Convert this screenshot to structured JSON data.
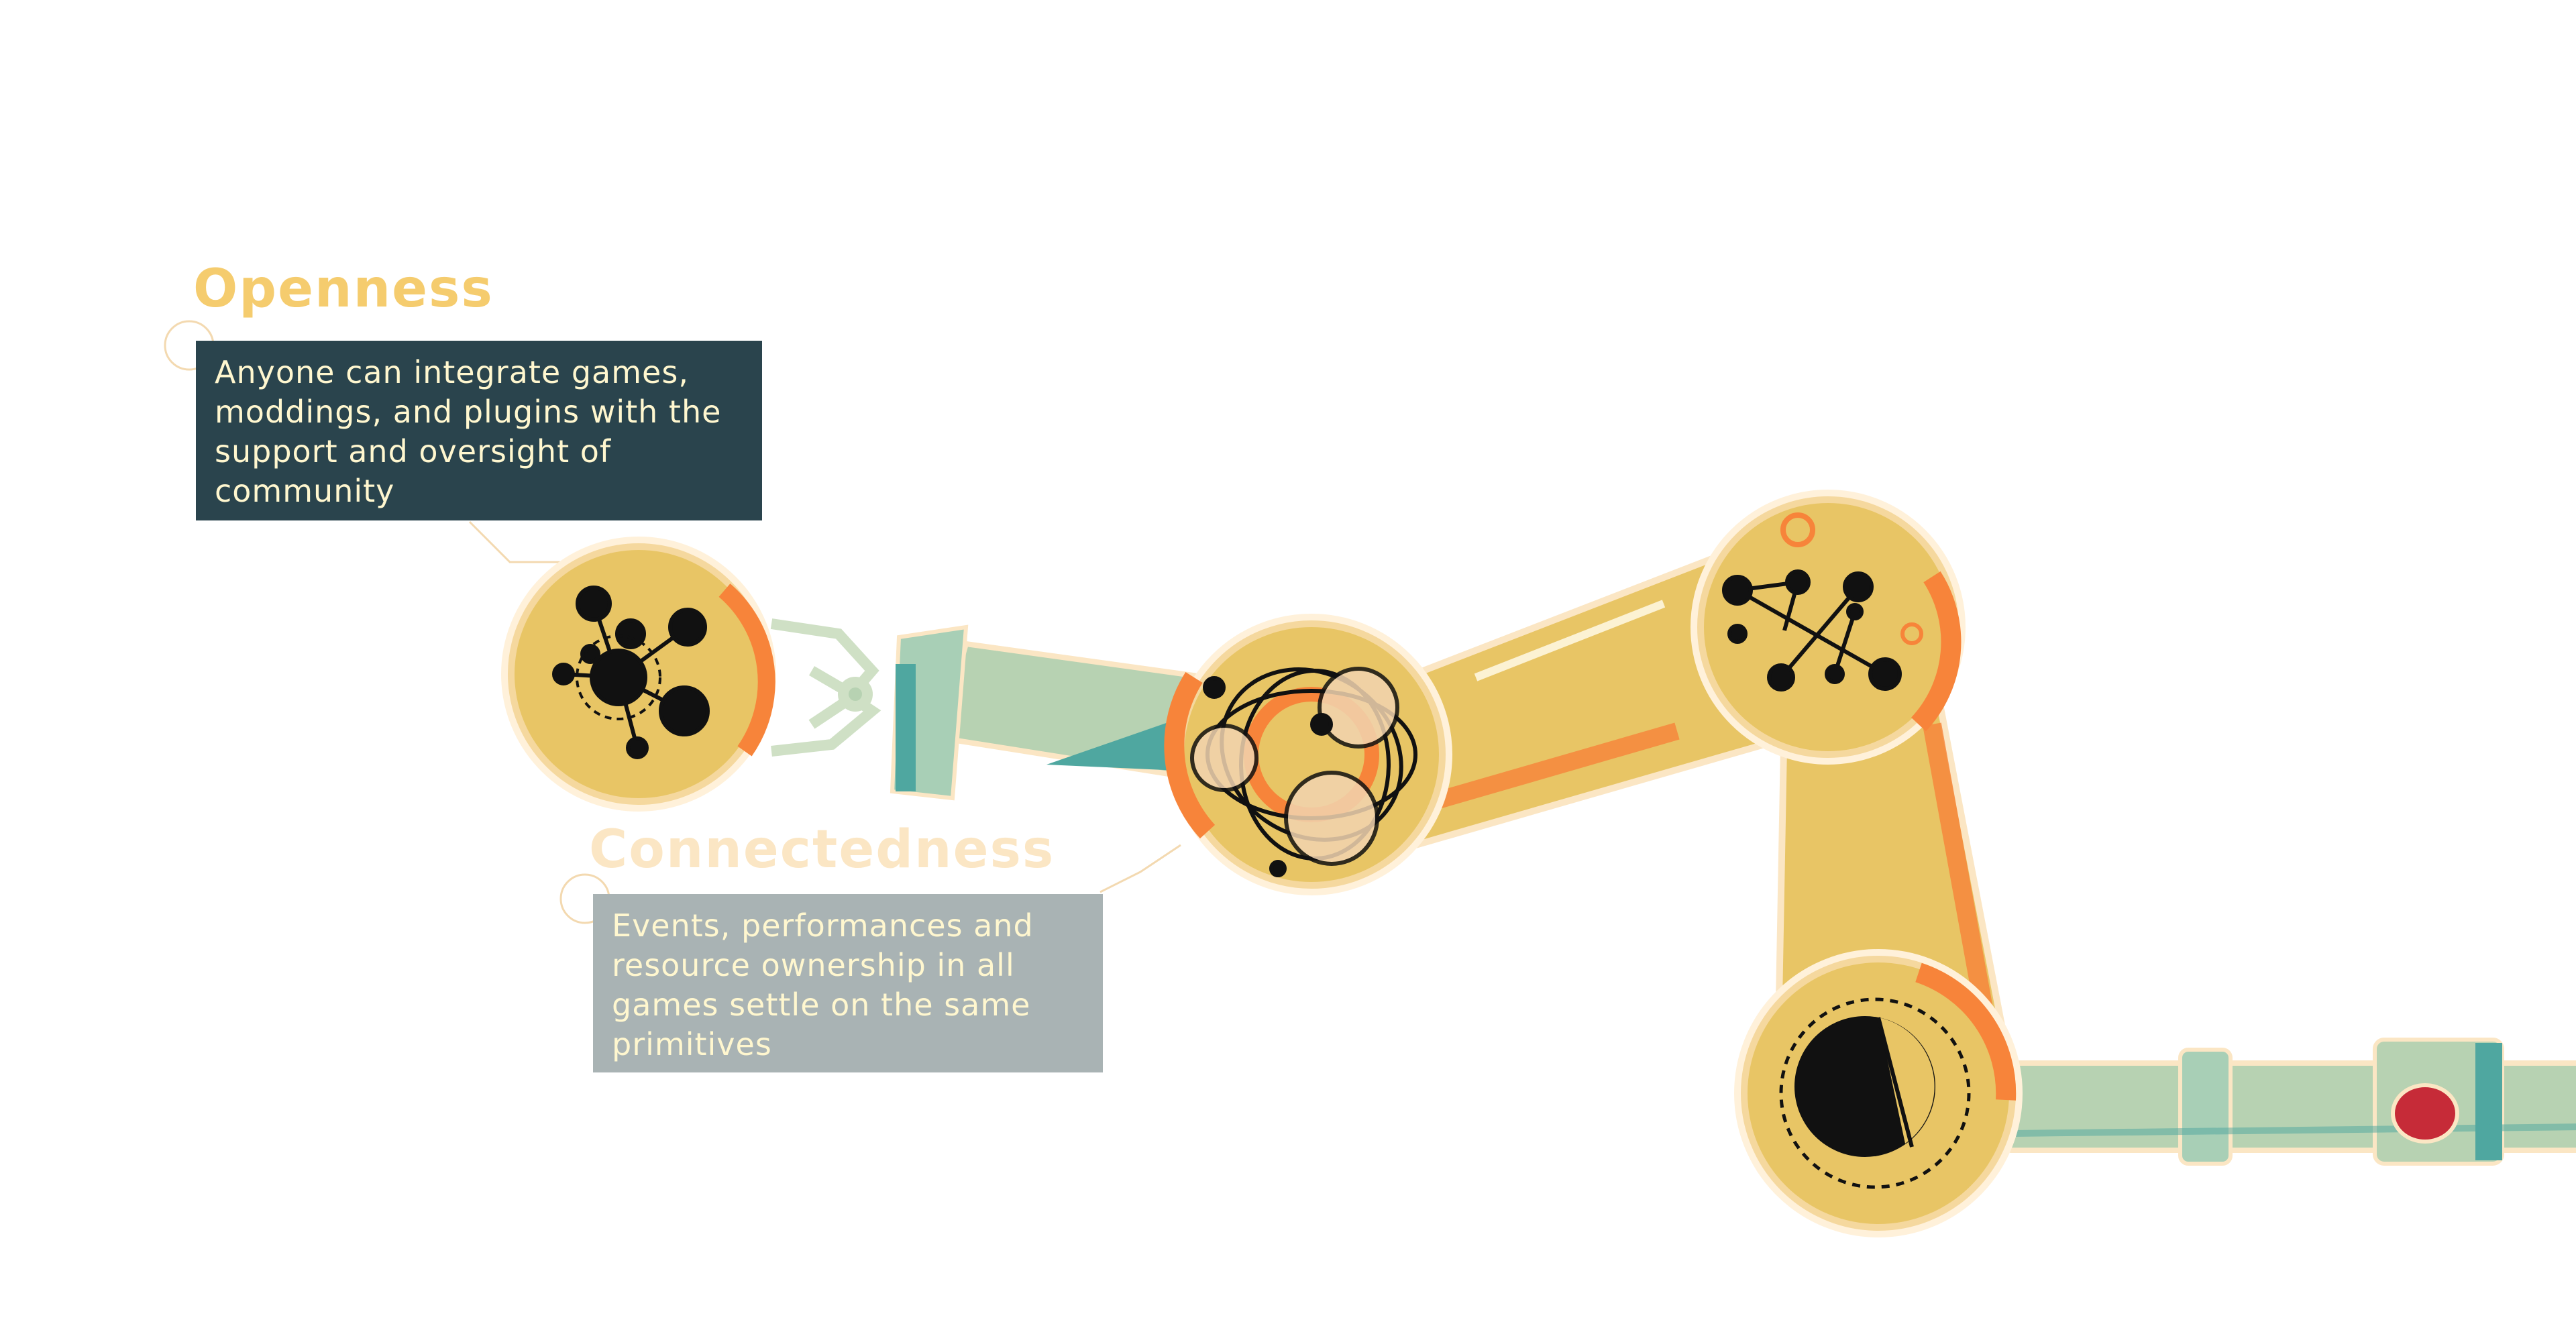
{
  "features": [
    {
      "id": "openness",
      "title": "Openness",
      "description": "Anyone can integrate games, moddings, and plugins with the support and oversight of community"
    },
    {
      "id": "connectedness",
      "title": "Connectedness",
      "description": "Events, performances and resource ownership in all games settle on the same primitives"
    }
  ],
  "colors": {
    "openness_title": "#f5cc6e",
    "openness_box": "#2a444d",
    "connectedness_title": "#fbe6c4",
    "connectedness_box": "#a9b3b4",
    "arm_yellow": "#e8c565",
    "arm_orange": "#f7843a",
    "pipe_green": "#b7d2b2",
    "pipe_teal": "#4fa7a0",
    "button_red": "#c62b38"
  }
}
